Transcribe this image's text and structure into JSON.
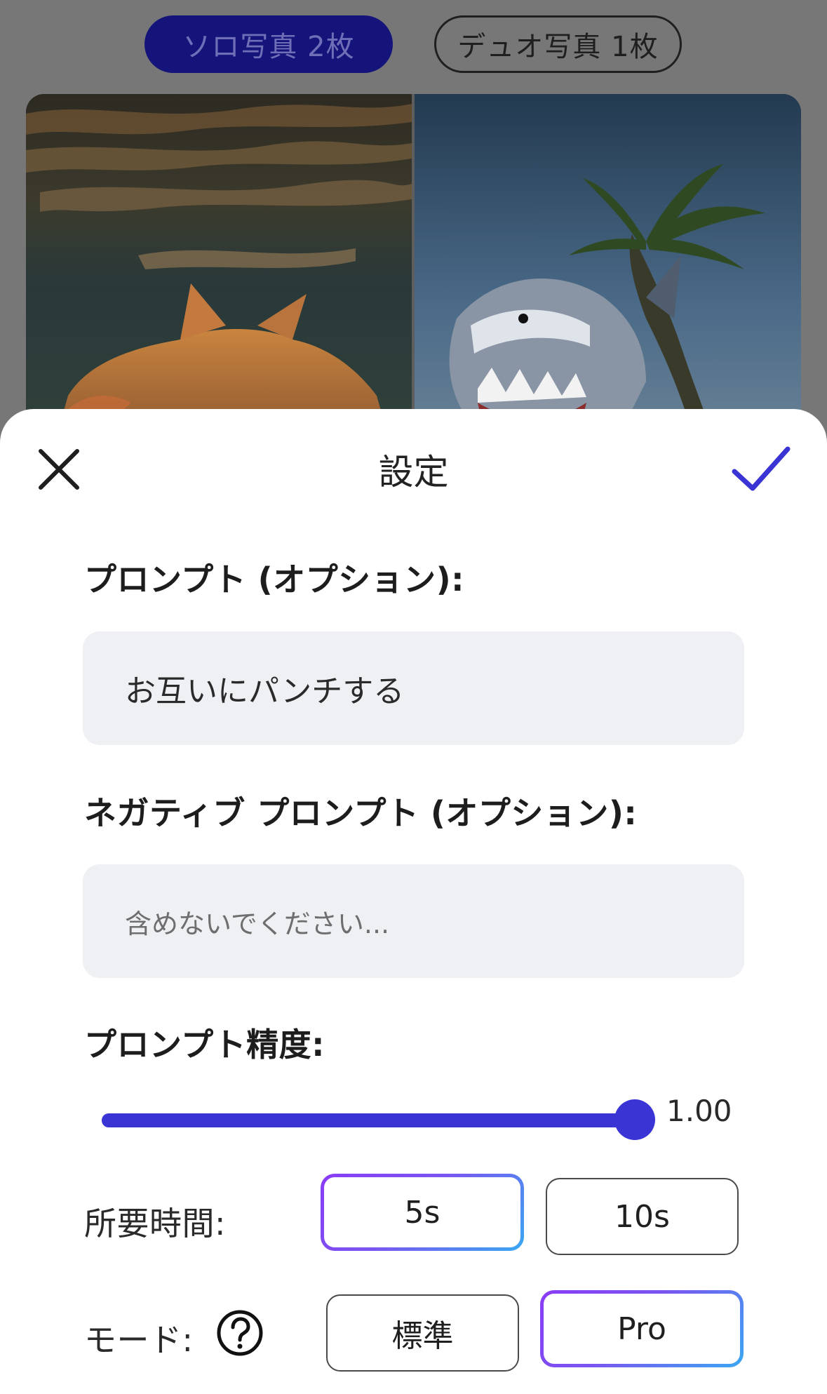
{
  "tabs": [
    {
      "label": "ソロ写真 2枚",
      "selected": true
    },
    {
      "label": "デュオ写真 1枚",
      "selected": false
    }
  ],
  "photos": [
    {
      "name": "cat-underwater-photo"
    },
    {
      "name": "shark-beach-photo"
    }
  ],
  "sheet": {
    "title": "設定",
    "close_icon": "close-icon",
    "confirm_icon": "checkmark-icon",
    "accent_color": "#3b34d4"
  },
  "prompt": {
    "label": "プロンプト (オプション):",
    "value": "お互いにパンチする"
  },
  "negative_prompt": {
    "label": "ネガティブ プロンプト (オプション):",
    "placeholder": "含めないでください..."
  },
  "precision": {
    "label": "プロンプト精度:",
    "value": 1.0,
    "value_text": "1.00",
    "min": 0,
    "max": 1
  },
  "duration": {
    "label": "所要時間:",
    "options": [
      "5s",
      "10s"
    ],
    "selected": "5s"
  },
  "mode": {
    "label": "モード:",
    "help_icon": "help-circle-icon",
    "options": [
      "標準",
      "Pro"
    ],
    "selected": "Pro"
  }
}
